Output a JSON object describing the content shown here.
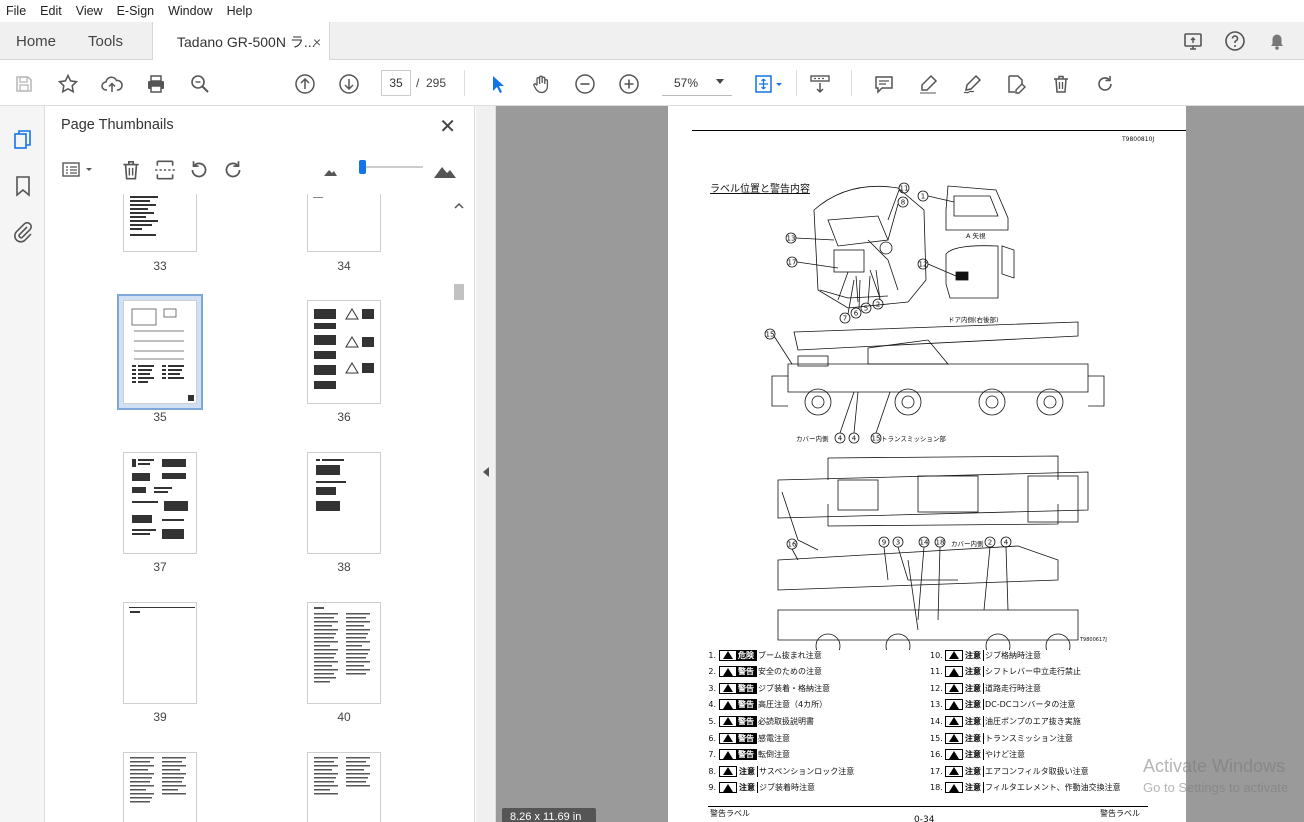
{
  "menu": [
    "File",
    "Edit",
    "View",
    "E-Sign",
    "Window",
    "Help"
  ],
  "tabs": {
    "home": "Home",
    "tools": "Tools",
    "doc": "Tadano GR-500N ラ...",
    "close": "×"
  },
  "toolbar": {
    "page_current": "35",
    "page_sep": "/",
    "page_total": "295",
    "zoom": "57%"
  },
  "panel": {
    "title": "Page Thumbnails",
    "close": "✕"
  },
  "thumbnails": [
    "33",
    "34",
    "35",
    "36",
    "37",
    "38",
    "39",
    "40"
  ],
  "document": {
    "code_top": "T9800810J",
    "heading": "ラベル位置と警告内容",
    "diagram_labels": {
      "view_a": "A 矢視",
      "door": "ドア内側(右後部)",
      "cover_inside": "カバー内側",
      "transmission": "トランスミッション部",
      "cover_inside2": "カバー内側",
      "fig_code": "T9800617J"
    },
    "legend_left": [
      {
        "n": "1.",
        "sign": "危険",
        "text": "ブーム抜まれ注意"
      },
      {
        "n": "2.",
        "sign": "警告",
        "text": "安全のための注意"
      },
      {
        "n": "3.",
        "sign": "警告",
        "text": "ジブ装着・格納注意"
      },
      {
        "n": "4.",
        "sign": "警告",
        "text": "高圧注意（4カ所）"
      },
      {
        "n": "5.",
        "sign": "警告",
        "text": "必読取扱説明書"
      },
      {
        "n": "6.",
        "sign": "警告",
        "text": "感電注意"
      },
      {
        "n": "7.",
        "sign": "警告",
        "text": "転倒注意"
      },
      {
        "n": "8.",
        "sign": "注意",
        "text": "サスペンションロック注意"
      },
      {
        "n": "9.",
        "sign": "注意",
        "text": "ジブ装着時注意"
      }
    ],
    "legend_right": [
      {
        "n": "10.",
        "sign": "注意",
        "text": "ジブ格納時注意"
      },
      {
        "n": "11.",
        "sign": "注意",
        "text": "シフトレバー中立走行禁止"
      },
      {
        "n": "12.",
        "sign": "注意",
        "text": "道路走行時注意"
      },
      {
        "n": "13.",
        "sign": "注意",
        "text": "DC-DCコンバータの注意"
      },
      {
        "n": "14.",
        "sign": "注意",
        "text": "油圧ポンプのエア抜き実施"
      },
      {
        "n": "15.",
        "sign": "注意",
        "text": "トランスミッション注意"
      },
      {
        "n": "16.",
        "sign": "注意",
        "text": "やけど注意"
      },
      {
        "n": "17.",
        "sign": "注意",
        "text": "エアコンフィルタ取扱い注意"
      },
      {
        "n": "18.",
        "sign": "注意",
        "text": "フィルタエレメント、作動油交換注意"
      }
    ],
    "footer_left": "警告ラベル",
    "footer_center": "0-34",
    "footer_right": "警告ラベル"
  },
  "page_size": "8.26 x 11.69 in",
  "watermark": {
    "line1": "Activate Windows",
    "line2": "Go to Settings to activate"
  }
}
